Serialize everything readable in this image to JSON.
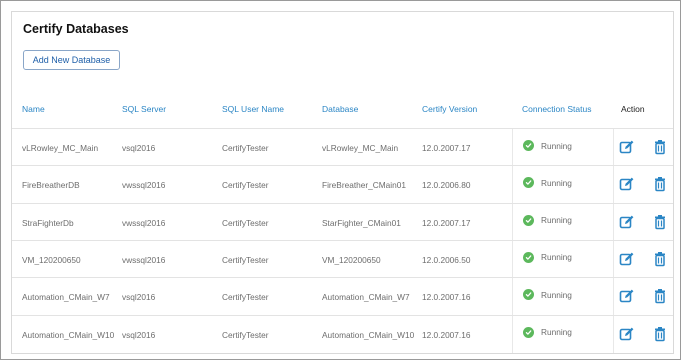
{
  "title": "Certify Databases",
  "add_button_label": "Add New Database",
  "columns": [
    "Name",
    "SQL Server",
    "SQL User Name",
    "Database",
    "Certify Version",
    "Connection Status",
    "Action"
  ],
  "rows": [
    {
      "name": "vLRowley_MC_Main",
      "server": "vsql2016",
      "user": "CertifyTester",
      "database": "vLRowley_MC_Main",
      "version": "12.0.2007.17",
      "status": "Running"
    },
    {
      "name": "FireBreatherDB",
      "server": "vwssql2016",
      "user": "CertifyTester",
      "database": "FireBreather_CMain01",
      "version": "12.0.2006.80",
      "status": "Running"
    },
    {
      "name": "StraFighterDb",
      "server": "vwssql2016",
      "user": "CertifyTester",
      "database": "StarFighter_CMain01",
      "version": "12.0.2007.17",
      "status": "Running"
    },
    {
      "name": "VM_120200650",
      "server": "vwssql2016",
      "user": "CertifyTester",
      "database": "VM_120200650",
      "version": "12.0.2006.50",
      "status": "Running"
    },
    {
      "name": "Automation_CMain_W7",
      "server": "vsql2016",
      "user": "CertifyTester",
      "database": "Automation_CMain_W7",
      "version": "12.0.2007.16",
      "status": "Running"
    },
    {
      "name": "Automation_CMain_W10",
      "server": "vsql2016",
      "user": "CertifyTester",
      "database": "Automation_CMain_W10",
      "version": "12.0.2007.16",
      "status": "Running"
    }
  ],
  "icons": {
    "status": "check-circle-icon",
    "edit": "edit-icon",
    "delete": "trash-icon"
  },
  "colors": {
    "header_text": "#2b86c5",
    "status_ok": "#5cb85c",
    "action_icon": "#2b86c5"
  }
}
